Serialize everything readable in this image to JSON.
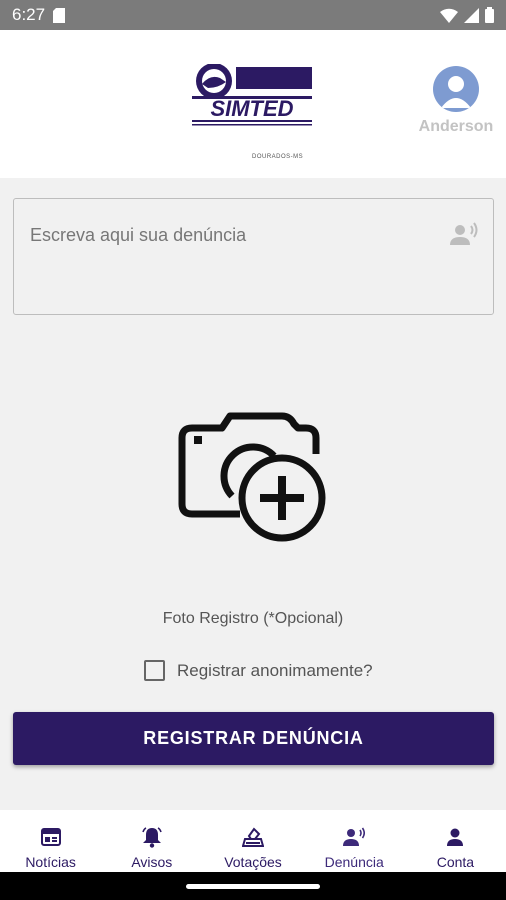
{
  "status_bar": {
    "time": "6:27"
  },
  "header": {
    "logo_text": "SIMTED",
    "logo_caption": "DOURADOS-MS",
    "user_name": "Anderson"
  },
  "form": {
    "placeholder": "Escreva aqui sua denúncia",
    "photo_label": "Foto Registro (*Opcional)",
    "anon_label": "Registrar anonimamente?",
    "anon_checked": false,
    "submit_label": "REGISTRAR DENÚNCIA"
  },
  "nav": {
    "items": [
      {
        "label": "Notícias",
        "icon": "news-icon"
      },
      {
        "label": "Avisos",
        "icon": "bell-icon"
      },
      {
        "label": "Votações",
        "icon": "vote-icon"
      },
      {
        "label": "Denúncia",
        "icon": "voice-report-icon"
      },
      {
        "label": "Conta",
        "icon": "person-icon"
      }
    ]
  },
  "colors": {
    "primary": "#2c1a63",
    "avatar": "#7e9bd1"
  }
}
